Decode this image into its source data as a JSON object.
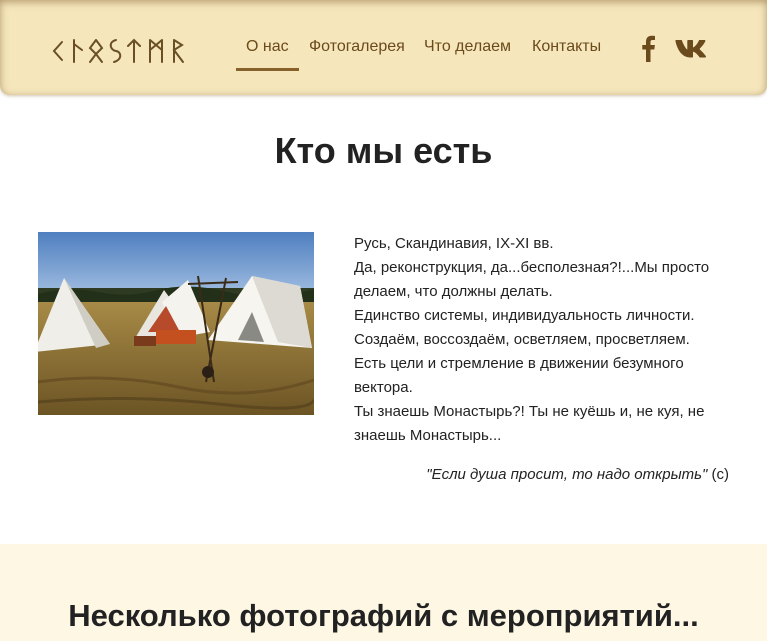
{
  "header": {
    "logo_text": "ᚲᚴᚢᛊᛏᛗᚱ",
    "logo_icon": "runic-logo",
    "nav": [
      {
        "label": "О нас",
        "active": true
      },
      {
        "label": "Фотогалерея",
        "active": false
      },
      {
        "label": "Что делаем",
        "active": false
      },
      {
        "label": "Контакты",
        "active": false
      }
    ],
    "social": [
      {
        "icon": "facebook-icon"
      },
      {
        "icon": "vk-icon"
      }
    ]
  },
  "about": {
    "title": "Кто мы есть",
    "photo_icon": "camp-tents-photo",
    "lines": [
      "Русь, Скандинавия, IX-XI вв.",
      "Да, реконструкция, да...бесполезная?!...Мы просто делаем, что должны делать.",
      "Единство системы, индивидуальность личности.",
      "Создаём, воссоздаём, осветляем, просветляем.",
      "Есть цели и стремление в движении безумного вектора.",
      "Ты знаешь Монастырь?! Ты не куёшь и, не куя, не знаешь Монастырь..."
    ],
    "quote": "\"Если душа просит, то надо открыть\"",
    "quote_suffix": " (с)"
  },
  "gallery": {
    "title": "Несколько фотографий с мероприятий..."
  },
  "colors": {
    "header_bg": "#f6e6bc",
    "nav_text": "#6b4a1b",
    "accent": "#86612a",
    "band_bg": "#fdf7e4"
  }
}
